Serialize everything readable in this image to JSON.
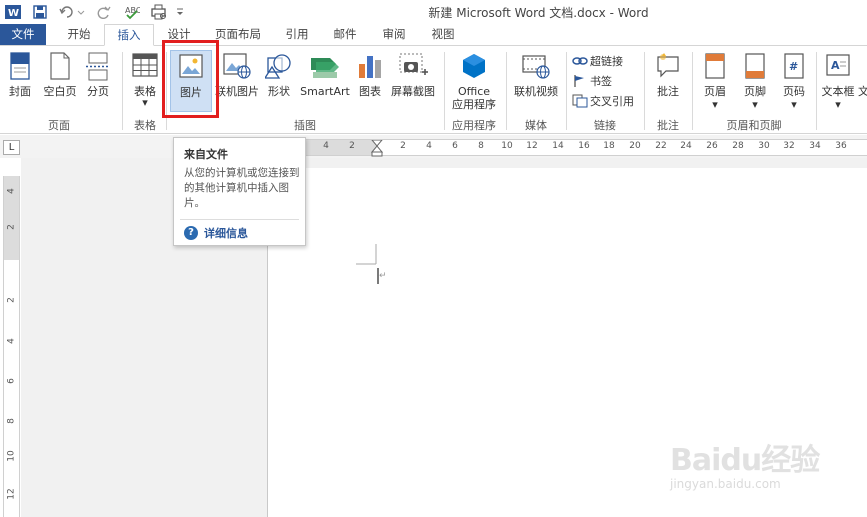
{
  "window": {
    "title": "新建 Microsoft Word 文档.docx - Word"
  },
  "tabs": [
    {
      "id": "file",
      "label": "文件"
    },
    {
      "id": "home",
      "label": "开始"
    },
    {
      "id": "insert",
      "label": "插入"
    },
    {
      "id": "design",
      "label": "设计"
    },
    {
      "id": "layout",
      "label": "页面布局"
    },
    {
      "id": "references",
      "label": "引用"
    },
    {
      "id": "mailings",
      "label": "邮件"
    },
    {
      "id": "review",
      "label": "审阅"
    },
    {
      "id": "view",
      "label": "视图"
    }
  ],
  "ribbon": {
    "pages": {
      "cover": "封面",
      "blank": "空白页",
      "break": "分页",
      "group": "页面"
    },
    "tables": {
      "table": "表格",
      "group": "表格"
    },
    "illustrations": {
      "picture": "图片",
      "online_picture": "联机图片",
      "shapes": "形状",
      "smartart": "SmartArt",
      "chart": "图表",
      "screenshot": "屏幕截图",
      "group": "插图"
    },
    "apps": {
      "office_line1": "Office",
      "office_line2": "应用程序",
      "group": "应用程序"
    },
    "media": {
      "online_video": "联机视频",
      "group": "媒体"
    },
    "links": {
      "hyperlink": "超链接",
      "bookmark": "书签",
      "crossref": "交叉引用",
      "group": "链接"
    },
    "comments": {
      "comment": "批注",
      "group": "批注"
    },
    "header_footer": {
      "header": "页眉",
      "footer": "页脚",
      "page_number": "页码",
      "group": "页眉和页脚"
    },
    "text": {
      "textbox": "文本框",
      "more": "文"
    }
  },
  "tooltip": {
    "title": "来自文件",
    "body": "从您的计算机或您连接到的其他计算机中插入图片。",
    "more": "详细信息",
    "help_glyph": "?"
  },
  "ruler": {
    "corner": "L",
    "h_ticks": [
      "4",
      "2",
      "2",
      "4",
      "6",
      "8",
      "10",
      "12",
      "14",
      "16",
      "18",
      "20",
      "22",
      "24",
      "26",
      "28",
      "30",
      "32",
      "34",
      "36"
    ],
    "v_ticks": [
      "4",
      "2",
      "2",
      "4",
      "6",
      "8",
      "10",
      "12"
    ]
  },
  "watermark": {
    "brand": "Baidu经验",
    "url": "jingyan.baidu.com"
  },
  "colors": {
    "accent": "#2b579a",
    "highlight": "#e21e1e",
    "selected_button": "#cfe0f4"
  }
}
